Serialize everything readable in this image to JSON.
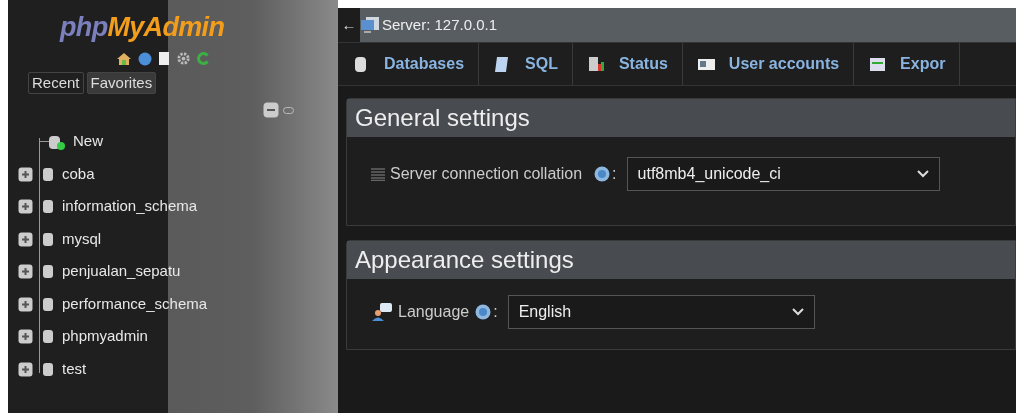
{
  "logo": {
    "part1": "php",
    "part2": "MyAdmin"
  },
  "nav_tabs": [
    {
      "label": "Recent",
      "selected": false
    },
    {
      "label": "Favorites",
      "selected": true
    }
  ],
  "tree": [
    {
      "label": "New",
      "kind": "new"
    },
    {
      "label": "coba",
      "kind": "db"
    },
    {
      "label": "information_schema",
      "kind": "db"
    },
    {
      "label": "mysql",
      "kind": "db"
    },
    {
      "label": "penjualan_sepatu",
      "kind": "db"
    },
    {
      "label": "performance_schema",
      "kind": "db"
    },
    {
      "label": "phpmyadmin",
      "kind": "db"
    },
    {
      "label": "test",
      "kind": "db"
    }
  ],
  "breadcrumb": {
    "back": "←",
    "server": "Server: 127.0.0.1"
  },
  "tabs": [
    {
      "label": "Databases",
      "kind": "db"
    },
    {
      "label": "SQL",
      "kind": "sql"
    },
    {
      "label": "Status",
      "kind": "status"
    },
    {
      "label": "User accounts",
      "kind": "users"
    },
    {
      "label": "Expor",
      "kind": "export"
    }
  ],
  "sections": [
    {
      "title": "General settings",
      "fields": [
        {
          "label": "Server connection collation",
          "kind": "collation",
          "suffix": ":",
          "value": "utf8mb4_unicode_ci"
        }
      ]
    },
    {
      "title": "Appearance settings",
      "fields": [
        {
          "label": "Language",
          "kind": "language",
          "suffix": ":",
          "value": "English"
        }
      ]
    }
  ]
}
